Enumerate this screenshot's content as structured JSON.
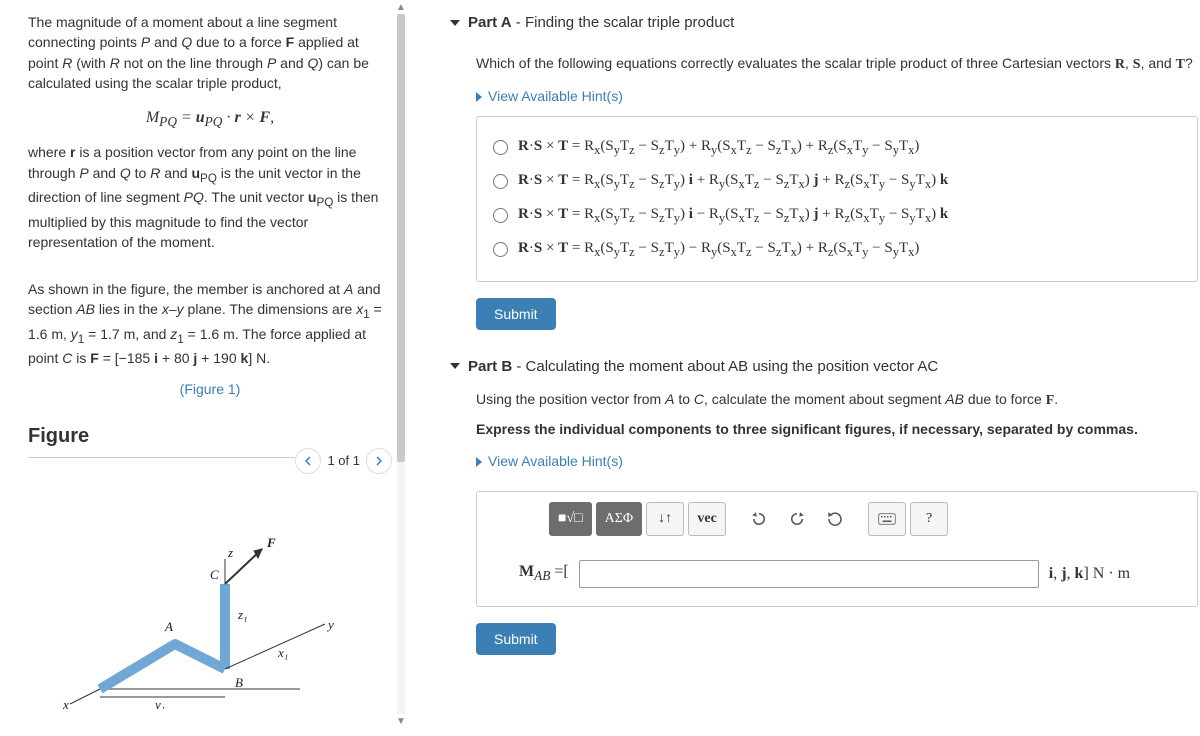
{
  "left": {
    "para1_html": "The magnitude of a moment about a line segment connecting points <i>P</i> and <i>Q</i> due to a force <b>F</b> applied at point <i>R</i> (with <i>R</i> not on the line through <i>P</i> and <i>Q</i>) can be calculated using the scalar triple product,",
    "formula_html": "M<sub>PQ</sub> = <b>u</b><sub>PQ</sub> · <b>r</b> × <b>F</b>,",
    "para2_html": "where <b>r</b> is a position vector from any point on the line through <i>P</i> and <i>Q</i> to <i>R</i> and <b>u</b><sub>PQ</sub> is the unit vector in the direction of line segment <i>PQ</i>. The unit vector <b>u</b><sub>PQ</sub> is then multiplied by this magnitude to find the vector representation of the moment.",
    "para3_html": "As shown in the figure, the member is anchored at <i>A</i> and section <i>AB</i> lies in the <i>x–y</i> plane. The dimensions are <i>x</i><sub>1</sub> = 1.6 m, <i>y</i><sub>1</sub> = 1.7 m, and <i>z</i><sub>1</sub> = 1.6 m. The force applied at point <i>C</i> is <b>F</b> = [−185 <b>i</b> + 80 <b>j</b> + 190 <b>k</b>] N.",
    "figure_link": "(Figure 1)",
    "figure_heading": "Figure",
    "figure_page": "1 of 1",
    "figure_labels": {
      "A": "A",
      "B": "B",
      "C": "C",
      "F": "F",
      "x": "x",
      "y": "y",
      "z": "z",
      "x1": "x₁",
      "y1": "y₁",
      "z1": "z₁"
    }
  },
  "partA": {
    "title": "Part A",
    "subtitle": " - Finding the scalar triple product",
    "question_html": "Which of the following equations correctly evaluates the scalar triple product of three Cartesian vectors <b style='font-family:serif'>R</b>, <b style='font-family:serif'>S</b>, and <b style='font-family:serif'>T</b>?",
    "hint": "View Available Hint(s)",
    "options": [
      "<b>R</b>·<b>S</b> × <b>T</b> = R<sub>x</sub>(S<sub>y</sub>T<sub>z</sub> − S<sub>z</sub>T<sub>y</sub>) + R<sub>y</sub>(S<sub>x</sub>T<sub>z</sub> − S<sub>z</sub>T<sub>x</sub>) + R<sub>z</sub>(S<sub>x</sub>T<sub>y</sub> − S<sub>y</sub>T<sub>x</sub>)",
      "<b>R</b>·<b>S</b> × <b>T</b> = R<sub>x</sub>(S<sub>y</sub>T<sub>z</sub> − S<sub>z</sub>T<sub>y</sub>) <b>i</b> + R<sub>y</sub>(S<sub>x</sub>T<sub>z</sub> − S<sub>z</sub>T<sub>x</sub>) <b>j</b> + R<sub>z</sub>(S<sub>x</sub>T<sub>y</sub> − S<sub>y</sub>T<sub>x</sub>) <b>k</b>",
      "<b>R</b>·<b>S</b> × <b>T</b> = R<sub>x</sub>(S<sub>y</sub>T<sub>z</sub> − S<sub>z</sub>T<sub>y</sub>) <b>i</b> − R<sub>y</sub>(S<sub>x</sub>T<sub>z</sub> − S<sub>z</sub>T<sub>x</sub>) <b>j</b> + R<sub>z</sub>(S<sub>x</sub>T<sub>y</sub> − S<sub>y</sub>T<sub>x</sub>) <b>k</b>",
      "<b>R</b>·<b>S</b> × <b>T</b> = R<sub>x</sub>(S<sub>y</sub>T<sub>z</sub> − S<sub>z</sub>T<sub>y</sub>) − R<sub>y</sub>(S<sub>x</sub>T<sub>z</sub> − S<sub>z</sub>T<sub>x</sub>) + R<sub>z</sub>(S<sub>x</sub>T<sub>y</sub> − S<sub>y</sub>T<sub>x</sub>)"
    ],
    "submit": "Submit"
  },
  "partB": {
    "title": "Part B",
    "subtitle": " - Calculating the moment about AB using the position vector AC",
    "question_html": "Using the position vector from <i>A</i> to <i>C</i>, calculate the moment about segment <i>AB</i> due to force <b style='font-family:serif'>F</b>.",
    "instruction": "Express the individual components to three significant figures, if necessary, separated by commas.",
    "hint": "View Available Hint(s)",
    "toolbar": {
      "template": "■√□",
      "greek": "ΑΣΦ",
      "subsup": "↓↑",
      "vec": "vec",
      "undo": "↶",
      "redo": "↷",
      "reset": "↻",
      "keyboard": "⌨",
      "help": "?"
    },
    "answer_prefix_html": "<b>M</b><sub><i>AB</i></sub> =[",
    "answer_value": "",
    "answer_suffix_html": "<b>i</b>, <b>j</b>, <b>k</b>] N · m",
    "submit": "Submit"
  }
}
